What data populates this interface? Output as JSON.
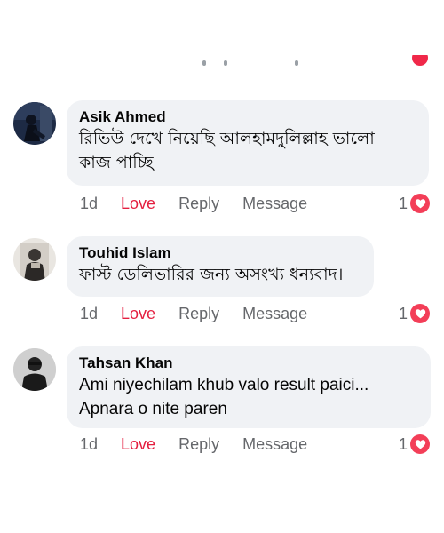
{
  "top_partial": {
    "note_icons": [
      "love-icon",
      "heart-reaction-icon"
    ]
  },
  "comments": [
    {
      "author": "Asik Ahmed",
      "text": "রিভিউ দেখে নিয়েছি আলহামদুলিল্লাহ ভালো\nকাজ পাচ্ছি",
      "time": "1d",
      "love_label": "Love",
      "reply_label": "Reply",
      "message_label": "Message",
      "reaction_count": "1",
      "reaction_icon": "heart-reaction-icon",
      "accent": "#e41e3f"
    },
    {
      "author": "Touhid Islam",
      "text": "ফাস্ট ডেলিভারির জন্য অসংখ্য ধন্যবাদ।",
      "time": "1d",
      "love_label": "Love",
      "reply_label": "Reply",
      "message_label": "Message",
      "reaction_count": "1",
      "reaction_icon": "heart-reaction-icon",
      "accent": "#e41e3f"
    },
    {
      "author": "Tahsan Khan",
      "text": "Ami niyechilam khub valo result paici...\nApnara o nite paren",
      "time": "1d",
      "love_label": "Love",
      "reply_label": "Reply",
      "message_label": "Message",
      "reaction_count": "1",
      "reaction_icon": "heart-reaction-icon",
      "accent": "#e41e3f"
    }
  ]
}
